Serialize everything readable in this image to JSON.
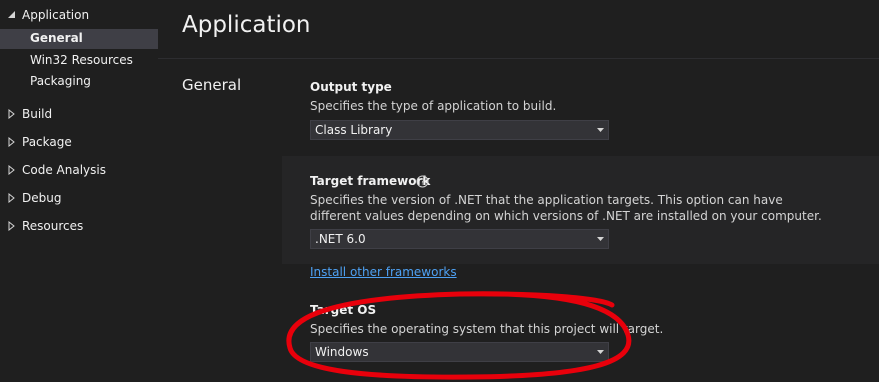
{
  "sidebar": {
    "application": {
      "label": "Application"
    },
    "application_children": [
      {
        "label": "General"
      },
      {
        "label": "Win32 Resources"
      },
      {
        "label": "Packaging"
      }
    ],
    "groups": [
      {
        "label": "Build"
      },
      {
        "label": "Package"
      },
      {
        "label": "Code Analysis"
      },
      {
        "label": "Debug"
      },
      {
        "label": "Resources"
      }
    ]
  },
  "main": {
    "page_title": "Application",
    "section_label": "General",
    "output_type": {
      "title": "Output type",
      "description": "Specifies the type of application to build.",
      "value": "Class Library"
    },
    "target_framework": {
      "title": "Target framework",
      "description": "Specifies the version of .NET that the application targets. This option can have different values depending on which versions of .NET are installed on your computer.",
      "value": ".NET 6.0",
      "link": "Install other frameworks"
    },
    "target_os": {
      "title": "Target OS",
      "description": "Specifies the operating system that this project will target.",
      "value": "Windows"
    }
  },
  "colors": {
    "background": "#1f1f1f",
    "selected_item": "#3f3f46",
    "dropdown_bg": "#333337",
    "link": "#4ea1f3",
    "annotation": "#e8000b"
  },
  "icons": [
    "expand-down-icon",
    "collapsed-arrow-icon",
    "help-icon",
    "dropdown-caret-icon"
  ]
}
